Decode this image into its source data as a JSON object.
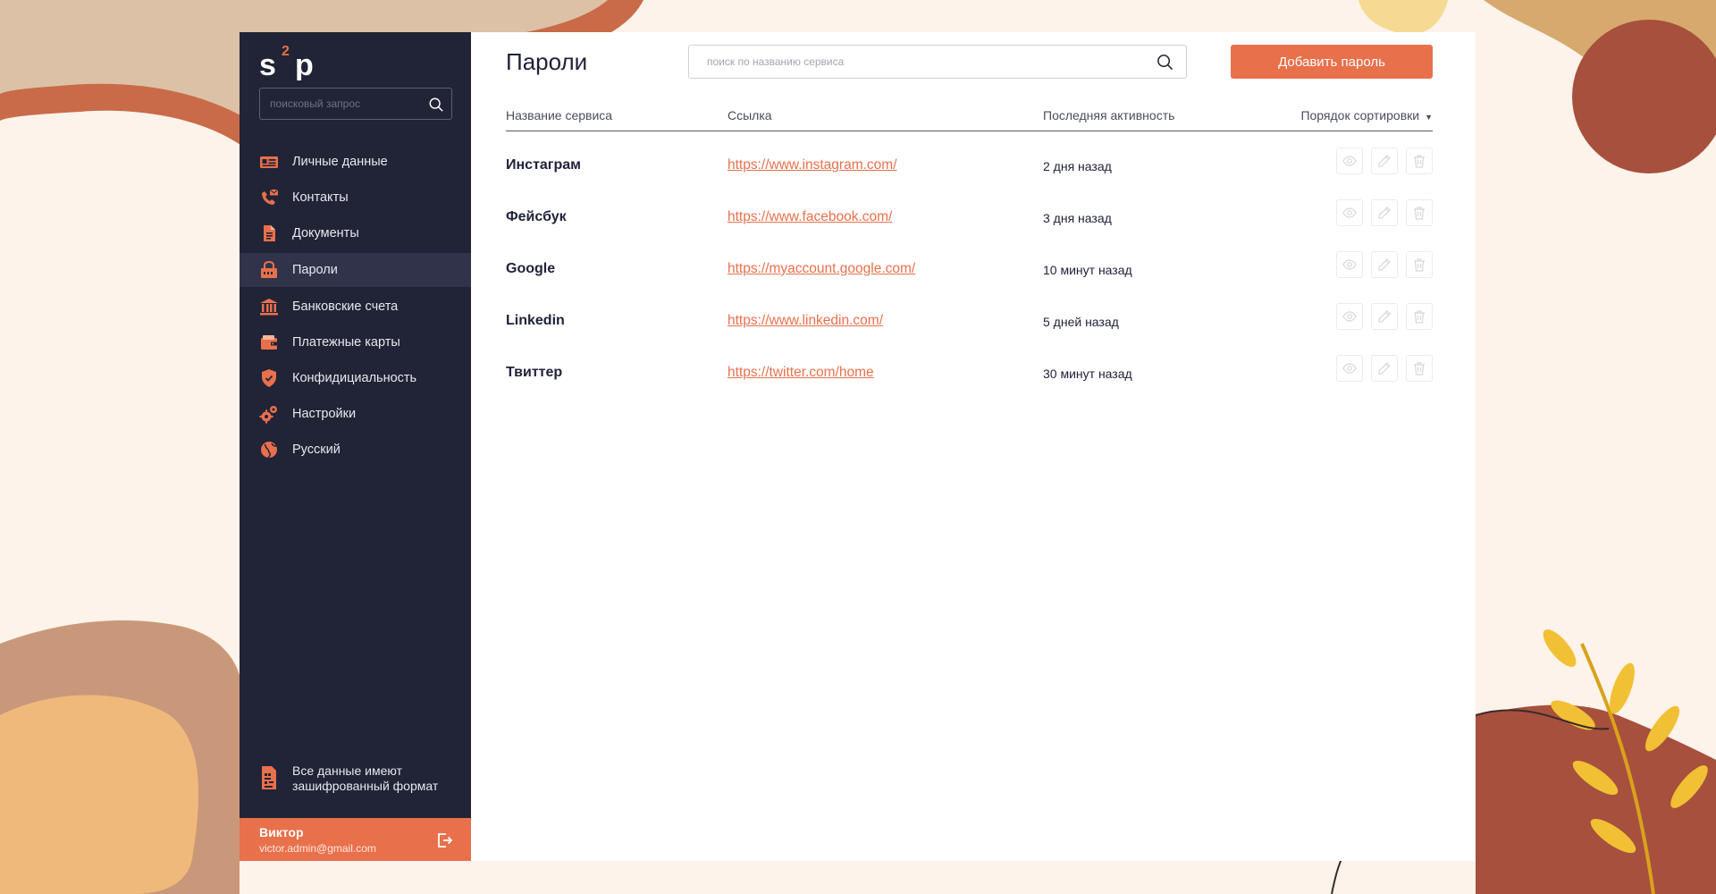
{
  "app": {
    "logo_text": "s2p",
    "accent_color": "#e8704b",
    "sidebar_color": "#212336"
  },
  "sidebar": {
    "search_placeholder": "поисковый запрос",
    "items": [
      {
        "label": "Личные данные",
        "icon": "id-card-icon"
      },
      {
        "label": "Контакты",
        "icon": "phone-mail-icon"
      },
      {
        "label": "Документы",
        "icon": "document-icon"
      },
      {
        "label": "Пароли",
        "icon": "password-icon",
        "active": true
      },
      {
        "label": "Банковские счета",
        "icon": "bank-icon"
      },
      {
        "label": "Платежные карты",
        "icon": "wallet-card-icon"
      },
      {
        "label": "Конфидициальность",
        "icon": "shield-icon"
      },
      {
        "label": "Настройки",
        "icon": "gears-icon"
      },
      {
        "label": "Русский",
        "icon": "globe-icon"
      }
    ],
    "encryption_note_line1": "Все данные имеют",
    "encryption_note_line2": "зашифрованный формат",
    "user": {
      "name": "Виктор",
      "email": "victor.admin@gmail.com"
    }
  },
  "main": {
    "title": "Пароли",
    "search_placeholder": "поиск по названию сервиса",
    "add_button": "Добавить пароль",
    "columns": {
      "service": "Название сервиса",
      "link": "Ссылка",
      "activity": "Последняя активность",
      "sort": "Порядок сортировки"
    },
    "rows": [
      {
        "service": "Инстаграм",
        "link": "https://www.instagram.com/",
        "activity": "2 дня назад"
      },
      {
        "service": "Фейсбук",
        "link": "https://www.facebook.com/",
        "activity": "3 дня назад"
      },
      {
        "service": "Google",
        "link": "https://myaccount.google.com/",
        "activity": "10 минут назад"
      },
      {
        "service": "Linkedin",
        "link": "https://www.linkedin.com/",
        "activity": "5 дней назад"
      },
      {
        "service": "Твиттер",
        "link": "https://twitter.com/home",
        "activity": "30 минут назад"
      }
    ]
  }
}
